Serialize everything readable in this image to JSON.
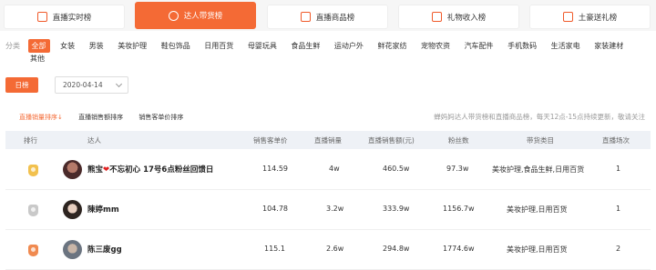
{
  "tabs": [
    {
      "label": "直播实时榜",
      "icon": "live-play-icon",
      "active": false
    },
    {
      "label": "达人带货榜",
      "icon": "heart-tag-icon",
      "active": true
    },
    {
      "label": "直播商品榜",
      "icon": "shopping-bag-icon",
      "active": false
    },
    {
      "label": "礼物收入榜",
      "icon": "gift-icon",
      "active": false
    },
    {
      "label": "土豪送礼榜",
      "icon": "money-bag-icon",
      "active": false
    }
  ],
  "categories": {
    "label": "分类",
    "items": [
      "全部",
      "女装",
      "男装",
      "美妆护理",
      "鞋包饰品",
      "日用百货",
      "母婴玩具",
      "食品生鲜",
      "运动户外",
      "鲜花家纺",
      "宠物农资",
      "汽车配件",
      "手机数码",
      "生活家电",
      "家装建材",
      "其他"
    ],
    "active": "全部"
  },
  "period": {
    "day_label": "日榜",
    "date": "2020-04-14"
  },
  "sorts": [
    "直播销量排序↓",
    "直播销售额排序",
    "销售客单价排序"
  ],
  "note": "蝉妈妈达人带货榜和直播商品榜，每天12点-15点持续更新，敬请关注",
  "table": {
    "headers": [
      "排行",
      "达人",
      "销售客单价",
      "直播销量",
      "直播销售额(元)",
      "粉丝数",
      "带货类目",
      "直播场次"
    ],
    "rows": [
      {
        "rank_icon": "gold-medal-icon",
        "name_pre": "熊宝",
        "name_heart": "❤",
        "name_post": "不忘初心 17号6点粉丝回馈日",
        "price": "114.59",
        "volume": "4w",
        "sales": "460.5w",
        "fans": "97.3w",
        "category": "美妆护理,食品生鲜,日用百货",
        "sessions": "1"
      },
      {
        "rank_icon": "silver-medal-icon",
        "name_pre": "陳婷mm",
        "name_heart": "",
        "name_post": "",
        "price": "104.78",
        "volume": "3.2w",
        "sales": "333.9w",
        "fans": "1156.7w",
        "category": "美妆护理,日用百货",
        "sessions": "1"
      },
      {
        "rank_icon": "bronze-medal-icon",
        "name_pre": "陈三废gg",
        "name_heart": "",
        "name_post": "",
        "price": "115.1",
        "volume": "2.6w",
        "sales": "294.8w",
        "fans": "1774.6w",
        "category": "美妆护理,日用百货",
        "sessions": "2"
      }
    ]
  },
  "colors": {
    "accent": "#f46a35",
    "gold": "#f2c14e",
    "silver": "#c9c9c9",
    "bronze": "#f08a50"
  }
}
